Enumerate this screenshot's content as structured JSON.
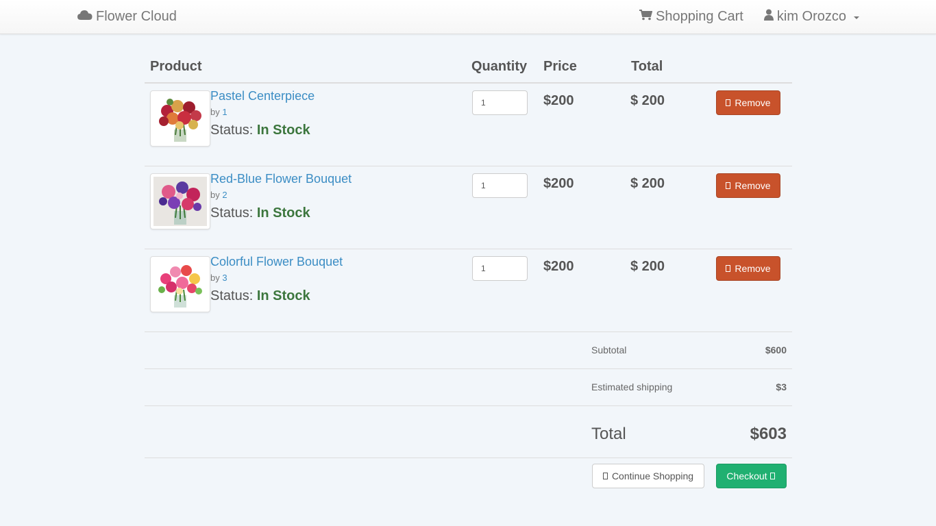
{
  "navbar": {
    "brand_icon": "cloud-icon",
    "brand": "Flower Cloud",
    "cart_icon": "shopping-cart-icon",
    "cart_label": "Shopping Cart",
    "user_icon": "user-icon",
    "user_name": "kim Orozco"
  },
  "table": {
    "headers": {
      "product": "Product",
      "quantity": "Quantity",
      "price": "Price",
      "total": "Total"
    }
  },
  "items": [
    {
      "name": "Pastel Centerpiece",
      "by_prefix": "by",
      "seller": "1",
      "status_label": "Status:",
      "status": "In Stock",
      "quantity": "1",
      "price": "$200",
      "total": "$ 200",
      "remove_label": "Remove"
    },
    {
      "name": "Red-Blue Flower Bouquet",
      "by_prefix": "by",
      "seller": "2",
      "status_label": "Status:",
      "status": "In Stock",
      "quantity": "1",
      "price": "$200",
      "total": "$ 200",
      "remove_label": "Remove"
    },
    {
      "name": "Colorful Flower Bouquet",
      "by_prefix": "by",
      "seller": "3",
      "status_label": "Status:",
      "status": "In Stock",
      "quantity": "1",
      "price": "$200",
      "total": "$ 200",
      "remove_label": "Remove"
    }
  ],
  "summary": {
    "subtotal_label": "Subtotal",
    "subtotal": "$600",
    "shipping_label": "Estimated shipping",
    "shipping": "$3",
    "total_label": "Total",
    "total": "$603"
  },
  "actions": {
    "continue_label": "Continue Shopping",
    "checkout_label": "Checkout"
  },
  "colors": {
    "remove": "#c8522b",
    "checkout": "#20b071",
    "link": "#3b8dc4",
    "in_stock": "#3c763d"
  }
}
